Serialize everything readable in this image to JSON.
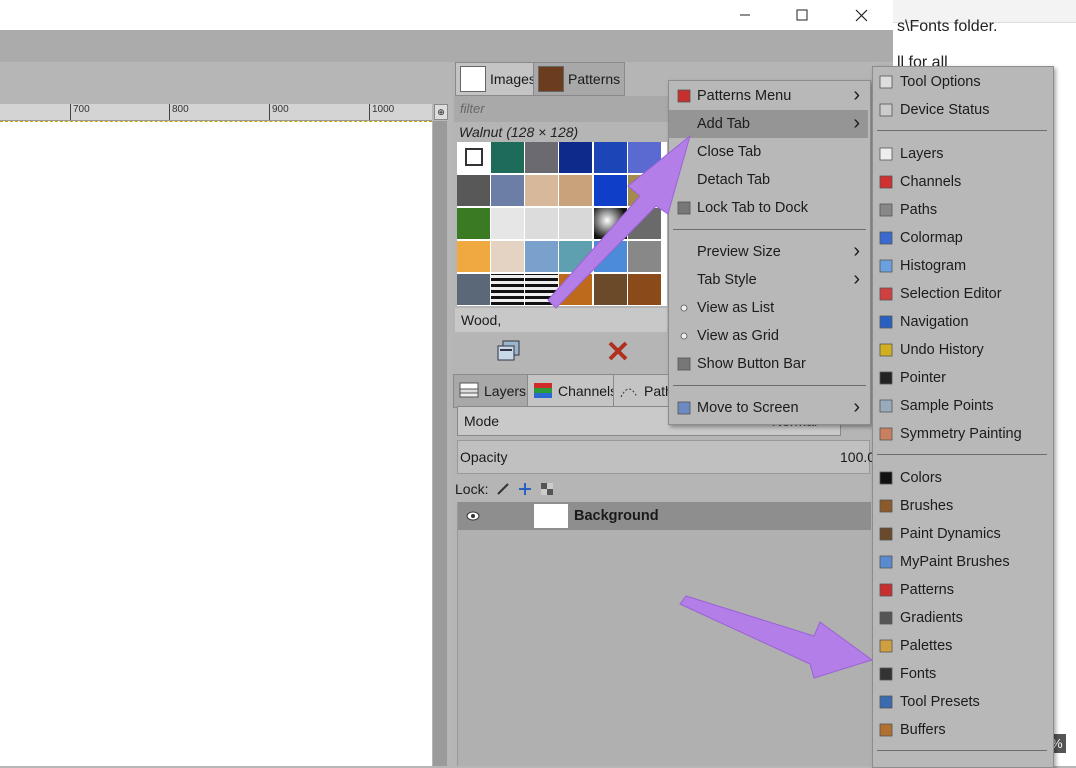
{
  "window": {
    "minimize_icon": "minimize-icon",
    "maximize_icon": "maximize-icon",
    "close_icon": "close-icon"
  },
  "background_doc": {
    "line1": "s\\Fonts folder.",
    "line2": "ll for all",
    "zoom": "%"
  },
  "ruler": {
    "ticks": [
      "700",
      "800",
      "900",
      "1000"
    ]
  },
  "dock_tabs": {
    "images": "Images",
    "patterns": "Patterns"
  },
  "patterns": {
    "filter_placeholder": "filter",
    "selected_title": "Walnut (128 × 128)",
    "tag_field": "Wood,",
    "grid_colors": [
      [
        "#ffffff",
        "#1f6b5a",
        "#6a6a70",
        "#0e2a8a",
        "#1c46b8",
        "#5a6ad0"
      ],
      [
        "#585858",
        "#6d7ea6",
        "#d8b89a",
        "#c7a27a",
        "#0f3ec8",
        "#a48a4c"
      ],
      [
        "#3a7a22",
        "#e6e6e6",
        "#dcdcdc",
        "#d8d8d8",
        "#222222",
        "#6a6a6a"
      ],
      [
        "#f0a840",
        "#e4d2c2",
        "#7aa0cc",
        "#5fa0b0",
        "#4b8bd8",
        "#888888"
      ],
      [
        "#5a6878",
        "#111111",
        "#222222",
        "#bd6a1c",
        "#6b4a2a",
        "#8a4a1a"
      ]
    ]
  },
  "layers_dock": {
    "tab_layers": "Layers",
    "tab_channels": "Channels",
    "tab_paths": "Path",
    "mode_label": "Mode",
    "mode_value": "Normal",
    "opacity_label": "Opacity",
    "opacity_value": "100.0",
    "lock_label": "Lock:",
    "layer_name": "Background"
  },
  "tab_menu": {
    "items": [
      {
        "label": "Patterns Menu",
        "icon": "patterns-icon",
        "submenu": true
      },
      {
        "label": "Add Tab",
        "icon": "",
        "submenu": true,
        "highlighted": true
      },
      {
        "label": "Close Tab",
        "icon": ""
      },
      {
        "label": "Detach Tab",
        "icon": ""
      },
      {
        "label": "Lock Tab to Dock",
        "icon": "checkbox-icon"
      },
      {
        "label": "Preview Size",
        "submenu": true
      },
      {
        "label": "Tab Style",
        "submenu": true
      },
      {
        "label": "View as List",
        "icon": "radio-icon"
      },
      {
        "label": "View as Grid",
        "icon": "radio-icon"
      },
      {
        "label": "Show Button Bar",
        "icon": "checkbox-icon"
      },
      {
        "label": "Move to Screen",
        "icon": "screen-icon",
        "submenu": true
      }
    ]
  },
  "add_tab_menu": {
    "items": [
      {
        "label": "Tool Options",
        "icon": "tool-options-icon"
      },
      {
        "label": "Device Status",
        "icon": "device-status-icon"
      },
      {
        "label": "Layers",
        "icon": "layers-icon"
      },
      {
        "label": "Channels",
        "icon": "channels-icon"
      },
      {
        "label": "Paths",
        "icon": "paths-icon"
      },
      {
        "label": "Colormap",
        "icon": "colormap-icon"
      },
      {
        "label": "Histogram",
        "icon": "histogram-icon"
      },
      {
        "label": "Selection Editor",
        "icon": "selection-editor-icon"
      },
      {
        "label": "Navigation",
        "icon": "navigation-icon"
      },
      {
        "label": "Undo History",
        "icon": "undo-history-icon"
      },
      {
        "label": "Pointer",
        "icon": "pointer-icon"
      },
      {
        "label": "Sample Points",
        "icon": "sample-points-icon"
      },
      {
        "label": "Symmetry Painting",
        "icon": "symmetry-icon"
      },
      {
        "label": "Colors",
        "icon": "colors-icon"
      },
      {
        "label": "Brushes",
        "icon": "brushes-icon"
      },
      {
        "label": "Paint Dynamics",
        "icon": "paint-dynamics-icon"
      },
      {
        "label": "MyPaint Brushes",
        "icon": "mypaint-brushes-icon"
      },
      {
        "label": "Patterns",
        "icon": "patterns-icon"
      },
      {
        "label": "Gradients",
        "icon": "gradients-icon"
      },
      {
        "label": "Palettes",
        "icon": "palettes-icon"
      },
      {
        "label": "Fonts",
        "icon": "fonts-icon"
      },
      {
        "label": "Tool Presets",
        "icon": "tool-presets-icon"
      },
      {
        "label": "Buffers",
        "icon": "buffers-icon"
      }
    ]
  },
  "colors": {
    "arrow": "#b37ee8",
    "menu_bg": "#b8b8b8",
    "highlight": "#959595"
  }
}
